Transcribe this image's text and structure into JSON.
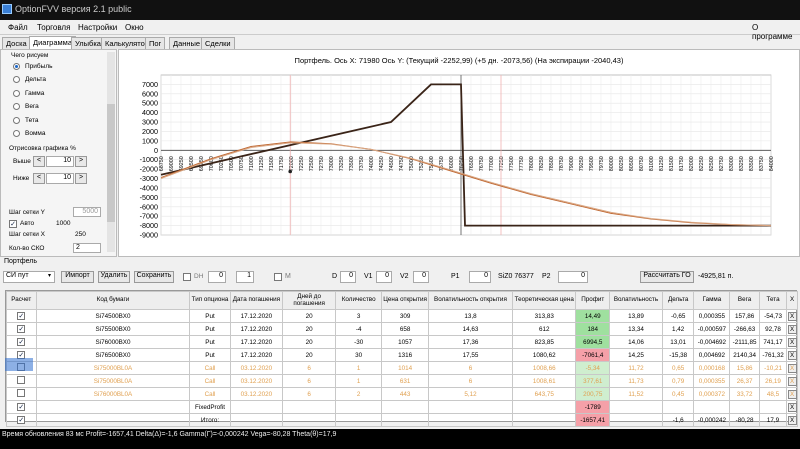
{
  "window": {
    "title": "OptionFVV версия 2.1 public"
  },
  "menu": {
    "items": [
      "Файл",
      "Торговля",
      "Настройки",
      "Окно"
    ],
    "about": "О программе"
  },
  "tabs": [
    "Доска",
    "Диаграмма",
    "Улыбка",
    "Калькулятор",
    "Пог",
    "Данные",
    "Сделки"
  ],
  "left": {
    "group_title": "Чего рисуем",
    "radios": [
      "Прибыль",
      "Дельта",
      "Гамма",
      "Вега",
      "Тета",
      "Вомма"
    ],
    "render_title": "Отрисовка графика %",
    "upper_label": "Выше",
    "upper_value": "10",
    "lower_label": "Ниже",
    "lower_value": "10",
    "gridy_label": "Шаг сетки Y",
    "gridy_value": "5000",
    "auto_label": "Авто",
    "auto_value": "1000",
    "gridx_label": "Шаг сетки X",
    "gridx_value": "250",
    "sko_label": "Кол-во СКО",
    "sko_value": "2"
  },
  "chart_data": {
    "type": "line",
    "title": "Портфель. Ось X: 71980 Ось Y:  (Текущий -2252,99)  (+5 дн. -2073,56)  (На экспирации -2040,43)",
    "ylim": [
      -9000,
      8000
    ],
    "yticks": [
      7000,
      6000,
      5000,
      4000,
      3000,
      2000,
      1000,
      0,
      -1000,
      -2000,
      -3000,
      -4000,
      -5000,
      -6000,
      -7000,
      -8000,
      -9000
    ],
    "xlim": [
      68750,
      84000
    ],
    "xticks": [
      "68750",
      "69000",
      "69250",
      "69500",
      "69750",
      "70000",
      "70250",
      "70500",
      "70750",
      "71000",
      "71250",
      "71500",
      "71750",
      "72000",
      "72250",
      "72500",
      "72750",
      "73000",
      "73250",
      "73500",
      "73750",
      "74000",
      "74250",
      "74500",
      "74750",
      "75000",
      "75250",
      "75500",
      "75750",
      "76000",
      "76250",
      "76500",
      "76750",
      "77000",
      "77250",
      "77500",
      "77750",
      "78000",
      "78250",
      "78500",
      "78750",
      "79000",
      "79250",
      "79500",
      "79750",
      "80000",
      "80250",
      "80500",
      "80750",
      "81000",
      "81250",
      "81500",
      "81750",
      "82000",
      "82250",
      "82500",
      "82750",
      "83000",
      "83250",
      "83500",
      "83750",
      "84000"
    ],
    "series": [
      {
        "color": "#3a2418",
        "x": [
          68750,
          74500,
          75500,
          76250,
          76350,
          76500,
          77000,
          84000
        ],
        "y": [
          -2600,
          3000,
          7000,
          7000,
          -8000,
          -8000,
          -8000,
          -8000
        ]
      },
      {
        "color": "#c06a35",
        "x": [
          68750,
          70000,
          71000,
          72000,
          73000,
          74000,
          75000,
          76000,
          77000,
          78000,
          79000,
          80000,
          81000,
          82000,
          83000,
          84000
        ],
        "y": [
          -2900,
          -900,
          400,
          900,
          700,
          100,
          -900,
          -2200,
          -3500,
          -4700,
          -5700,
          -6700,
          -7300,
          -7700,
          -7900,
          -8000
        ]
      },
      {
        "color": "#d9a682",
        "x": [
          68750,
          70000,
          71000,
          72000,
          73000,
          74000,
          75000,
          76000,
          77000,
          78000,
          79000,
          80000,
          81000,
          82000,
          83000,
          84000
        ],
        "y": [
          -3000,
          -1000,
          300,
          800,
          650,
          100,
          -850,
          -2100,
          -3400,
          -4600,
          -5600,
          -6600,
          -7250,
          -7650,
          -7880,
          -8000
        ]
      }
    ],
    "markers": {
      "current_x": 76250,
      "red_x": [
        71980,
        77250
      ]
    }
  },
  "portfolio_label": "Портфель",
  "toolbar": {
    "combo": "СИ пут",
    "import": "Импорт",
    "delete": "Удалить",
    "save": "Сохранить",
    "dh": "DH",
    "dh_v1": "0",
    "dh_v2": "1",
    "m": "M",
    "d_lbl": "D",
    "d_val": "0",
    "v1_lbl": "V1",
    "v1_val": "0",
    "v2_lbl": "V2",
    "v2_val": "0",
    "p1_lbl": "P1",
    "p1_val": "0",
    "si_lbl": "SiZ0 76377",
    "p2_lbl": "P2",
    "p2_val": "0",
    "calc": "Рассчитать ГО",
    "go_val": "-4925,81 п."
  },
  "table": {
    "headers": [
      "Расчет",
      "Код бумаги",
      "Тип опциона",
      "Дата погашения",
      "Дней до погашения",
      "Количество",
      "Цена открытия",
      "Волатильность открытия",
      "Теоретическая цена",
      "Профит",
      "Волатильность",
      "Дельта",
      "Гамма",
      "Вега",
      "Тета",
      "X"
    ],
    "rows": [
      {
        "chk": "✓",
        "c": [
          "Si74500BX0",
          "Put",
          "17.12.2020",
          "20",
          "3",
          "309",
          "13,8",
          "313,83",
          "14,49",
          "13,89",
          "-0,65",
          "0,000355",
          "157,86",
          "-54,73"
        ],
        "cls": "",
        "pcls": "pos"
      },
      {
        "chk": "✓",
        "c": [
          "Si75500BX0",
          "Put",
          "17.12.2020",
          "20",
          "-4",
          "658",
          "14,63",
          "612",
          "184",
          "13,34",
          "1,42",
          "-0,000597",
          "-266,63",
          "92,78"
        ],
        "cls": "",
        "pcls": "pos"
      },
      {
        "chk": "✓",
        "c": [
          "Si76000BX0",
          "Put",
          "17.12.2020",
          "20",
          "-30",
          "1057",
          "17,36",
          "823,85",
          "6994,5",
          "14,06",
          "13,01",
          "-0,004692",
          "-2111,85",
          "741,17"
        ],
        "cls": "",
        "pcls": "pos"
      },
      {
        "chk": "✓",
        "c": [
          "Si76500BX0",
          "Put",
          "17.12.2020",
          "20",
          "30",
          "1316",
          "17,55",
          "1080,62",
          "-7061,4",
          "14,25",
          "-15,38",
          "0,004692",
          "2140,34",
          "-761,32"
        ],
        "cls": "",
        "pcls": "neg"
      },
      {
        "chk": "",
        "c": [
          "Si75000BL0A",
          "Call",
          "03.12.2020",
          "6",
          "1",
          "1014",
          "6",
          "1008,66",
          "-5,34",
          "11,72",
          "0,65",
          "0,000168",
          "15,86",
          "-10,21"
        ],
        "cls": "dim",
        "pcls": "posdim"
      },
      {
        "chk": "",
        "c": [
          "Si75000BL0A",
          "Call",
          "03.12.2020",
          "6",
          "1",
          "631",
          "6",
          "1008,61",
          "377,61",
          "11,73",
          "0,79",
          "0,000355",
          "26,37",
          "26,19"
        ],
        "cls": "dim",
        "pcls": "posdim"
      },
      {
        "chk": "",
        "c": [
          "Si76000BL0A",
          "Call",
          "03.12.2020",
          "6",
          "2",
          "443",
          "5,12",
          "643,75",
          "200,75",
          "11,52",
          "0,45",
          "0,000372",
          "33,72",
          "48,5"
        ],
        "cls": "dim",
        "pcls": "posdim"
      },
      {
        "chk": "✓",
        "c": [
          "",
          "FixedProfit",
          "",
          "",
          "",
          "",
          "",
          "",
          "-1789",
          "",
          "",
          "",
          "",
          ""
        ],
        "cls": "",
        "pcls": "neg"
      },
      {
        "chk": "✓",
        "c": [
          "",
          "Итого:",
          "",
          "",
          "",
          "",
          "",
          "",
          "-1657,41",
          "",
          "-1,6",
          "-0,000242",
          "-80,28",
          "17,9"
        ],
        "cls": "",
        "pcls": "neg"
      }
    ]
  },
  "status": "Время обновления 83 мс  Profit=-1657,41 Delta(Δ)=-1,6 Gamma(Γ)=-0,000242 Vega=-80,28 Theta(θ)=17,9"
}
